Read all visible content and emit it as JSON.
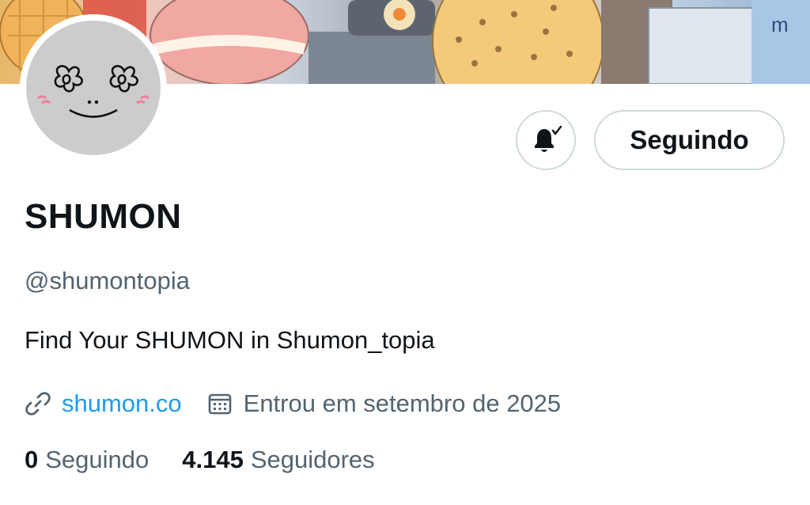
{
  "profile": {
    "name": "SHUMON",
    "handle": "@shumontopia",
    "bio": "Find Your SHUMON in Shumon_topia",
    "link": "shumon.co",
    "joined": "Entrou em setembro de 2025"
  },
  "actions": {
    "notifications_icon": "bell-check-icon",
    "follow_label": "Seguindo"
  },
  "stats": {
    "following_count": "0",
    "following_label": "Seguindo",
    "followers_count": "4.145",
    "followers_label": "Seguidores"
  },
  "colors": {
    "text_primary": "#0f1419",
    "text_secondary": "#536471",
    "link": "#1d9bf0",
    "border": "#cfd9de"
  }
}
